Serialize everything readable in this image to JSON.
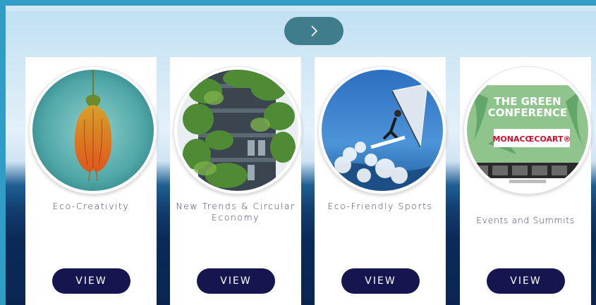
{
  "navigation": {
    "next_icon": "chevron-right-icon"
  },
  "cards": [
    {
      "title": "Eco-Creativity",
      "button_label": "VIEW",
      "image": "orange-flower-bell"
    },
    {
      "title": "New Trends & Circular Economy",
      "button_label": "VIEW",
      "image": "vertical-forest-building"
    },
    {
      "title": "Eco-Friendly Sports",
      "button_label": "VIEW",
      "image": "windsurfer-jumping"
    },
    {
      "title": "Events and Summits",
      "button_label": "VIEW",
      "image": "green-conference-screen",
      "image_text": {
        "heading_line1": "THE GREEN",
        "heading_line2": "CONFERENCE",
        "logo": "MONACŒCOART®"
      }
    }
  ],
  "colors": {
    "button_bg": "#151650",
    "arrow_button_bg": "#3f7d8c",
    "title_text": "#3a3a6e",
    "outer_border": "#2f9dc6"
  }
}
